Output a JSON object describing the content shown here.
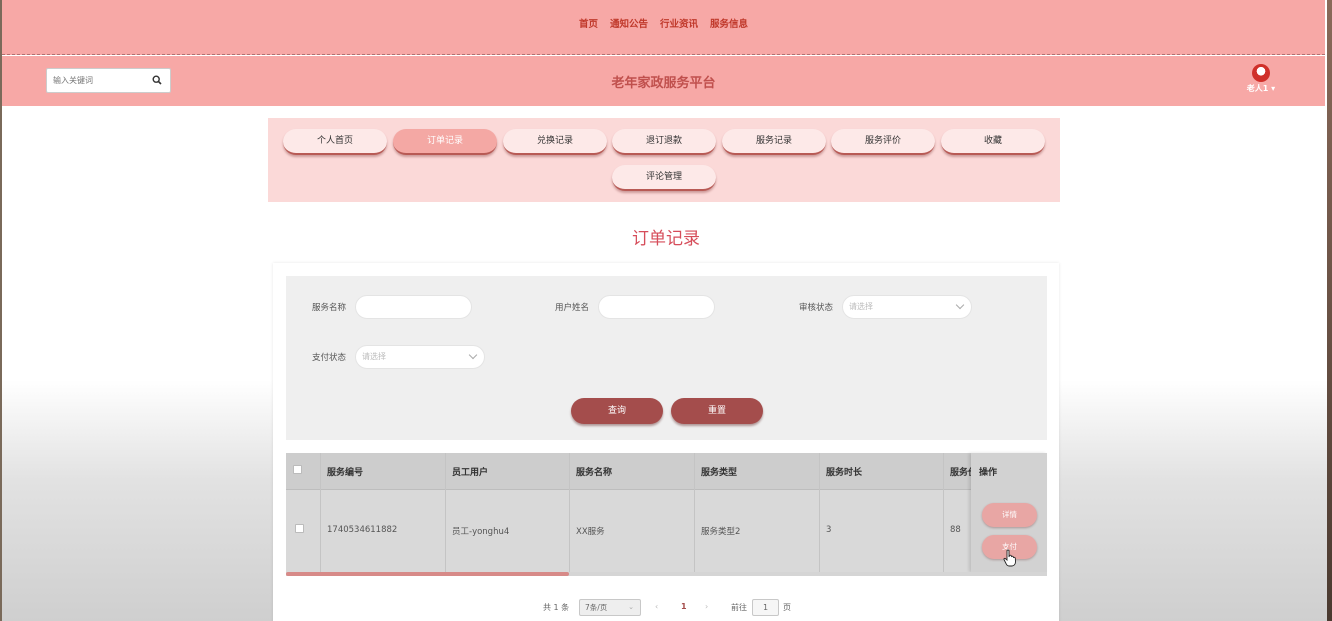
{
  "nav": {
    "links": [
      "首页",
      "通知公告",
      "行业资讯",
      "服务信息"
    ]
  },
  "header": {
    "search_placeholder": "输入关键词",
    "site_title": "老年家政服务平台",
    "user_name": "老人1"
  },
  "menu": {
    "items": [
      "个人首页",
      "订单记录",
      "兑换记录",
      "退订退款",
      "服务记录",
      "服务评价",
      "收藏",
      "评论管理"
    ],
    "active": "订单记录"
  },
  "page": {
    "title": "订单记录"
  },
  "filters": {
    "service_name_label": "服务名称",
    "user_name_label": "用户姓名",
    "review_status_label": "审核状态",
    "review_status_value": "请选择",
    "pay_status_label": "支付状态",
    "pay_status_value": "请选择",
    "query_button": "查询",
    "reset_button": "重置"
  },
  "table": {
    "headers": [
      "服务编号",
      "员工用户",
      "服务名称",
      "服务类型",
      "服务时长",
      "服务价",
      "操作"
    ],
    "rows": [
      {
        "service_no": "1740534611882",
        "staff_user": "员工-yonghu4",
        "service_name": "XX服务",
        "service_type": "服务类型2",
        "duration": "3",
        "price": "88",
        "actions": [
          "详情",
          "支付"
        ]
      }
    ]
  },
  "pagination": {
    "total": "共 1 条",
    "page_size": "7条/页",
    "current_page": "1",
    "goto_label": "前往",
    "goto_value": "1",
    "page_suffix": "页"
  },
  "colors": {
    "header_bg": "#f7a8a6",
    "accent": "#a44d4c",
    "title": "#d64d5a"
  }
}
